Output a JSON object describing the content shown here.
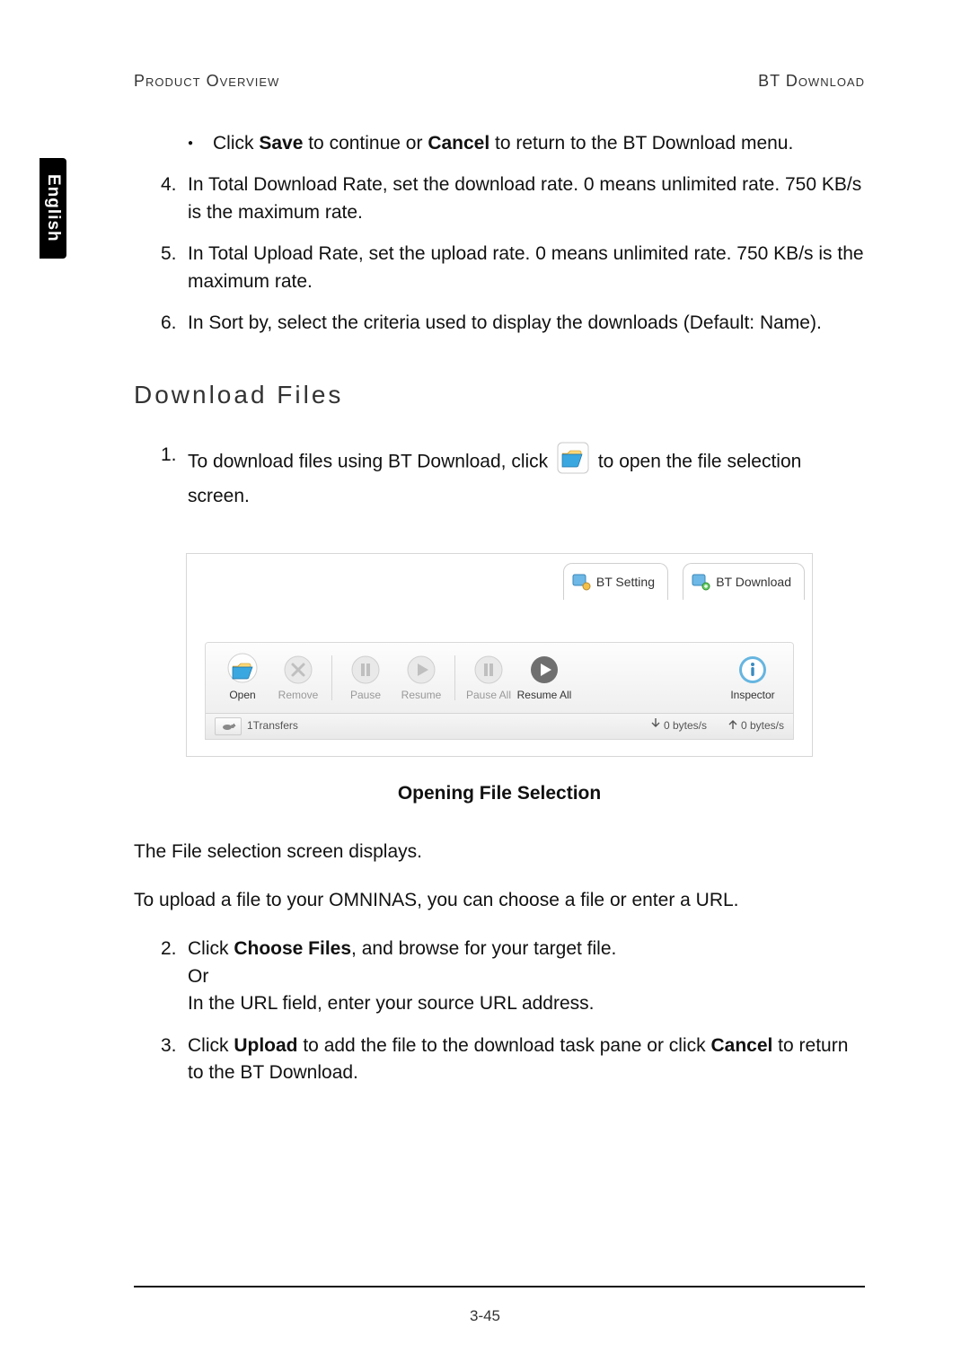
{
  "header": {
    "left": "Product Overview",
    "right": "BT Download"
  },
  "side_tab": "English",
  "intro_bullet": {
    "click": "Click ",
    "save": "Save",
    "mid1": " to continue or ",
    "cancel": "Cancel",
    "mid2": " to return to the BT Download menu."
  },
  "steps_a": [
    {
      "n": "4.",
      "text": "In Total Download Rate, set the download rate. 0 means unlimited rate. 750 KB/s is the maximum rate."
    },
    {
      "n": "5.",
      "text": "In Total Upload Rate, set the upload rate. 0 means unlimited rate. 750 KB/s is the maximum rate."
    },
    {
      "n": "6.",
      "text": "In Sort by, select the criteria used to display the downloads (Default: Name)."
    }
  ],
  "section_title": "Download Files",
  "step1": {
    "n": "1.",
    "a": "To download files using BT Download, click",
    "b": "to open the file selection screen."
  },
  "ui": {
    "tabs": {
      "setting": "BT Setting",
      "download": "BT Download"
    },
    "toolbar": {
      "open": {
        "label": "Open",
        "enabled": true
      },
      "remove": {
        "label": "Remove",
        "enabled": false
      },
      "pause": {
        "label": "Pause",
        "enabled": false
      },
      "resume": {
        "label": "Resume",
        "enabled": false
      },
      "pause_all": {
        "label": "Pause All",
        "enabled": false
      },
      "resume_all": {
        "label": "Resume All",
        "enabled": true
      },
      "inspector": {
        "label": "Inspector",
        "enabled": true
      }
    },
    "status": {
      "transfers": "1Transfers",
      "down": "0 bytes/s",
      "up": "0 bytes/s"
    }
  },
  "figure_caption": "Opening File Selection",
  "para1": "The File selection screen displays.",
  "para2": "To upload a file to your OMNINAS, you can choose a file or enter a URL.",
  "step2": {
    "n": "2.",
    "a": "Click ",
    "b_bold": "Choose Files",
    "c": ", and browse for your target file.",
    "or": "Or",
    "d": "In the URL field, enter your source URL address."
  },
  "step3": {
    "n": "3.",
    "a": "Click ",
    "b_bold": "Upload",
    "c": " to add the file to the download task pane or click ",
    "d_bold": "Cancel",
    "e": " to return to the BT Download."
  },
  "page_num": "3-45"
}
